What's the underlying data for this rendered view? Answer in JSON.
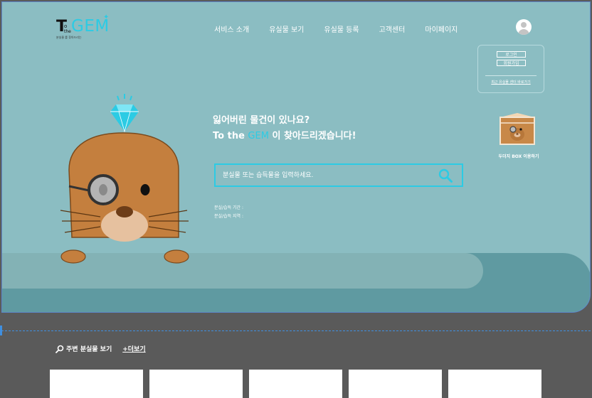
{
  "logo": {
    "t": "T",
    "o": "o",
    "the": "the",
    "gem": "GEM",
    "sparkle": "✦",
    "tag": "분실물      를 찾아드리는"
  },
  "nav": {
    "items": [
      {
        "label": "서비스 소개"
      },
      {
        "label": "유실물 보기"
      },
      {
        "label": "유실물 등록"
      },
      {
        "label": "고객센터"
      },
      {
        "label": "마이페이지"
      }
    ]
  },
  "user_panel": {
    "login": "로그인",
    "signup": "회원가입",
    "shortcut": "최근 유실물 센터 바로가기"
  },
  "box": {
    "label": "두더지 BOX 이용하기"
  },
  "headline": {
    "line1": "잃어버린 물건이 있나요?",
    "line2_prefix": "To the ",
    "line2_gem": "GEM",
    "line2_suffix": " 이 찾아드리겠습니다!"
  },
  "search": {
    "placeholder": "분실물 또는 습득물을 입력하세요."
  },
  "filters": {
    "period": "분실/습득 기간 :",
    "region": "분실/습득 지역 :"
  },
  "nearby": {
    "title": "주변 분실물 보기",
    "more": "+더보기"
  },
  "colors": {
    "hero_bg": "#8bbdc2",
    "accent": "#2ccbe4",
    "dark_bg": "#5a5a5a",
    "mole": "#c47f3e"
  }
}
